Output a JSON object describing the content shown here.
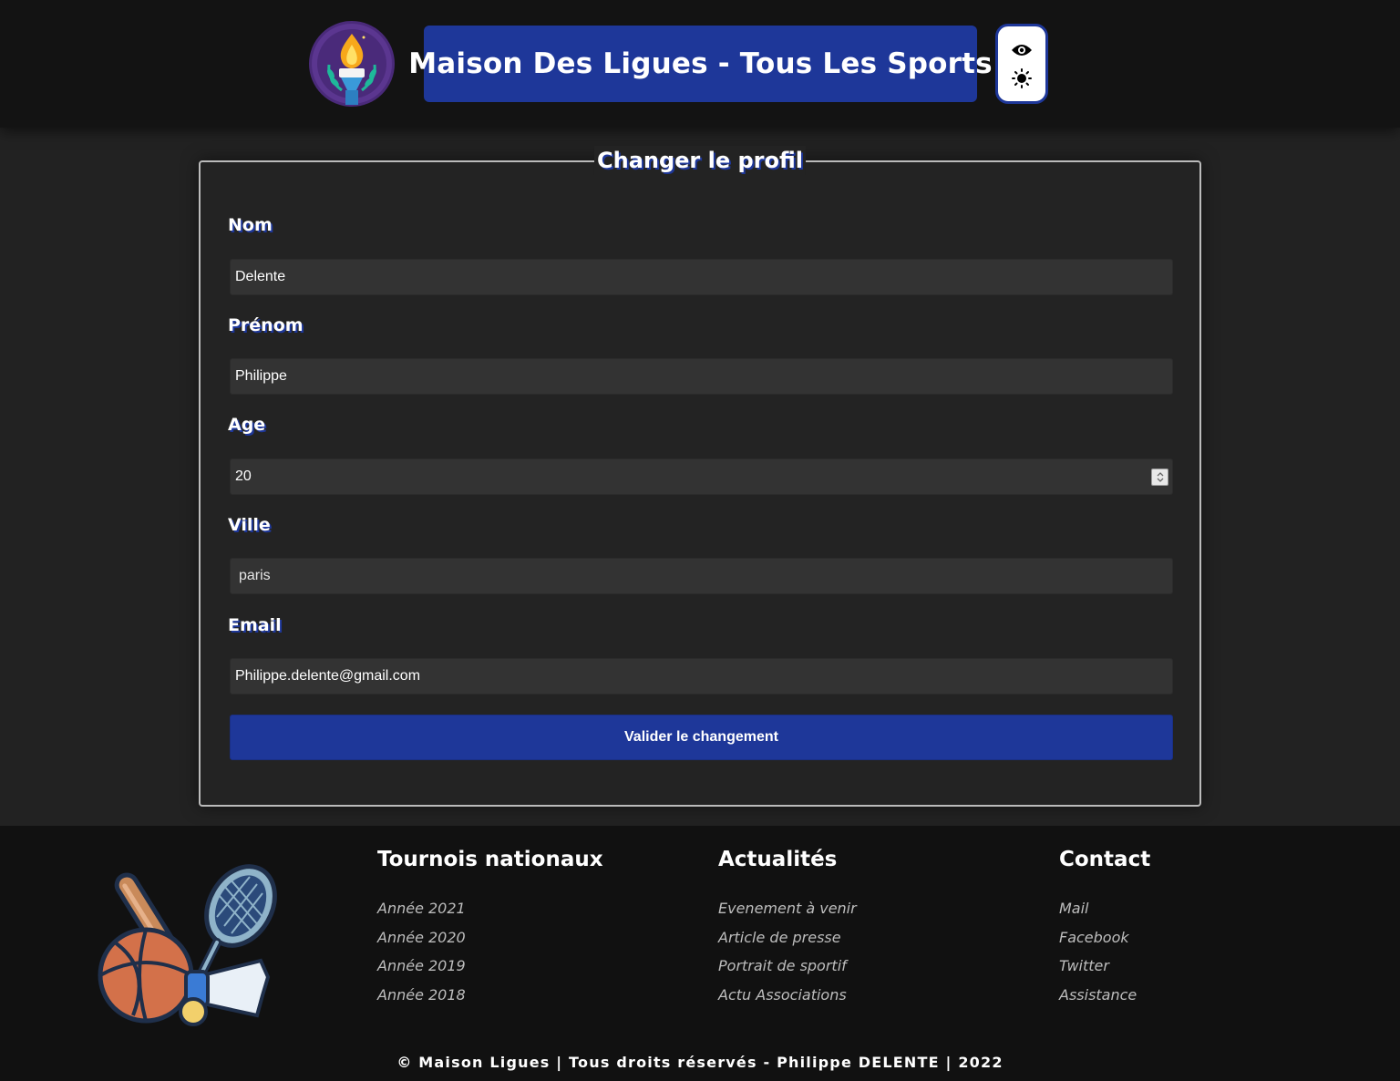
{
  "header": {
    "title": "Maison Des Ligues - Tous Les Sports",
    "logo_icon": "olympic-torch-icon",
    "toggle_icons": [
      "eye-icon",
      "sun-icon"
    ]
  },
  "form": {
    "legend": "Changer le profil",
    "fields": [
      {
        "label": "Nom",
        "value": "Delente"
      },
      {
        "label": "Prénom",
        "value": "Philippe"
      },
      {
        "label": "Age",
        "value": "20"
      },
      {
        "label": "Ville",
        "value": "paris"
      },
      {
        "label": "Email",
        "value": "Philippe.delente@gmail.com"
      }
    ],
    "submit_label": "Valider le changement"
  },
  "footer": {
    "illustration_icon": "sports-equipment-icon",
    "columns": [
      {
        "title": "Tournois nationaux",
        "items": [
          "Année 2021",
          "Année 2020",
          "Année 2019",
          "Année 2018"
        ]
      },
      {
        "title": "Actualités",
        "items": [
          "Evenement à venir",
          "Article de presse",
          "Portrait de sportif",
          "Actu Associations"
        ]
      },
      {
        "title": "Contact",
        "items": [
          "Mail",
          "Facebook",
          "Twitter",
          "Assistance"
        ]
      }
    ],
    "copyright": "© Maison Ligues | Tous droits réservés - Philippe DELENTE | 2022"
  },
  "colors": {
    "accent": "#1e3799",
    "background": "#222222",
    "header_bg": "#131313",
    "footer_bg": "#111111",
    "input_bg": "#333333"
  }
}
